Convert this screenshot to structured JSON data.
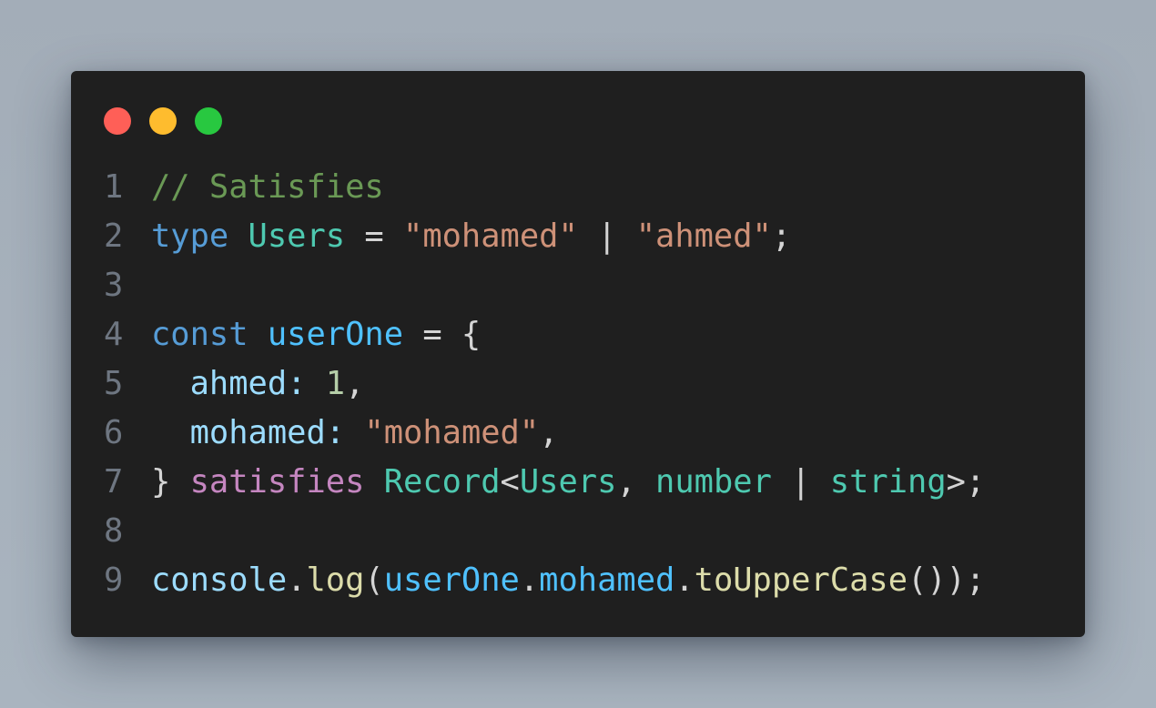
{
  "window": {
    "controls": {
      "close_color": "#ff5f57",
      "minimize_color": "#febc2e",
      "maximize_color": "#28c840"
    }
  },
  "code": {
    "language": "typescript",
    "lines": [
      {
        "number": "1",
        "tokens": [
          {
            "text": "// Satisfies",
            "kind": "comment"
          }
        ]
      },
      {
        "number": "2",
        "tokens": [
          {
            "text": "type",
            "kind": "kw-type"
          },
          {
            "text": " ",
            "kind": "plain"
          },
          {
            "text": "Users",
            "kind": "typename"
          },
          {
            "text": " = ",
            "kind": "plain"
          },
          {
            "text": "\"mohamed\"",
            "kind": "string"
          },
          {
            "text": " | ",
            "kind": "plain"
          },
          {
            "text": "\"ahmed\"",
            "kind": "string"
          },
          {
            "text": ";",
            "kind": "plain"
          }
        ]
      },
      {
        "number": "3",
        "tokens": []
      },
      {
        "number": "4",
        "tokens": [
          {
            "text": "const",
            "kind": "kw-type"
          },
          {
            "text": " ",
            "kind": "plain"
          },
          {
            "text": "userOne",
            "kind": "var"
          },
          {
            "text": " = {",
            "kind": "plain"
          }
        ]
      },
      {
        "number": "5",
        "tokens": [
          {
            "text": "  ",
            "kind": "plain"
          },
          {
            "text": "ahmed",
            "kind": "prop"
          },
          {
            "text": ": ",
            "kind": "prop"
          },
          {
            "text": "1",
            "kind": "num"
          },
          {
            "text": ",",
            "kind": "plain"
          }
        ]
      },
      {
        "number": "6",
        "tokens": [
          {
            "text": "  ",
            "kind": "plain"
          },
          {
            "text": "mohamed",
            "kind": "prop"
          },
          {
            "text": ": ",
            "kind": "prop"
          },
          {
            "text": "\"mohamed\"",
            "kind": "string"
          },
          {
            "text": ",",
            "kind": "plain"
          }
        ]
      },
      {
        "number": "7",
        "tokens": [
          {
            "text": "} ",
            "kind": "plain"
          },
          {
            "text": "satisfies",
            "kind": "kw-ctrl"
          },
          {
            "text": " ",
            "kind": "plain"
          },
          {
            "text": "Record",
            "kind": "typename"
          },
          {
            "text": "<",
            "kind": "plain"
          },
          {
            "text": "Users",
            "kind": "typename"
          },
          {
            "text": ", ",
            "kind": "plain"
          },
          {
            "text": "number",
            "kind": "typename"
          },
          {
            "text": " | ",
            "kind": "plain"
          },
          {
            "text": "string",
            "kind": "typename"
          },
          {
            "text": ">;",
            "kind": "plain"
          }
        ]
      },
      {
        "number": "8",
        "tokens": []
      },
      {
        "number": "9",
        "tokens": [
          {
            "text": "console",
            "kind": "prop"
          },
          {
            "text": ".",
            "kind": "plain"
          },
          {
            "text": "log",
            "kind": "fn"
          },
          {
            "text": "(",
            "kind": "plain"
          },
          {
            "text": "userOne",
            "kind": "var"
          },
          {
            "text": ".",
            "kind": "plain"
          },
          {
            "text": "mohamed",
            "kind": "var"
          },
          {
            "text": ".",
            "kind": "plain"
          },
          {
            "text": "toUpperCase",
            "kind": "fn"
          },
          {
            "text": "());",
            "kind": "plain"
          }
        ]
      }
    ]
  }
}
